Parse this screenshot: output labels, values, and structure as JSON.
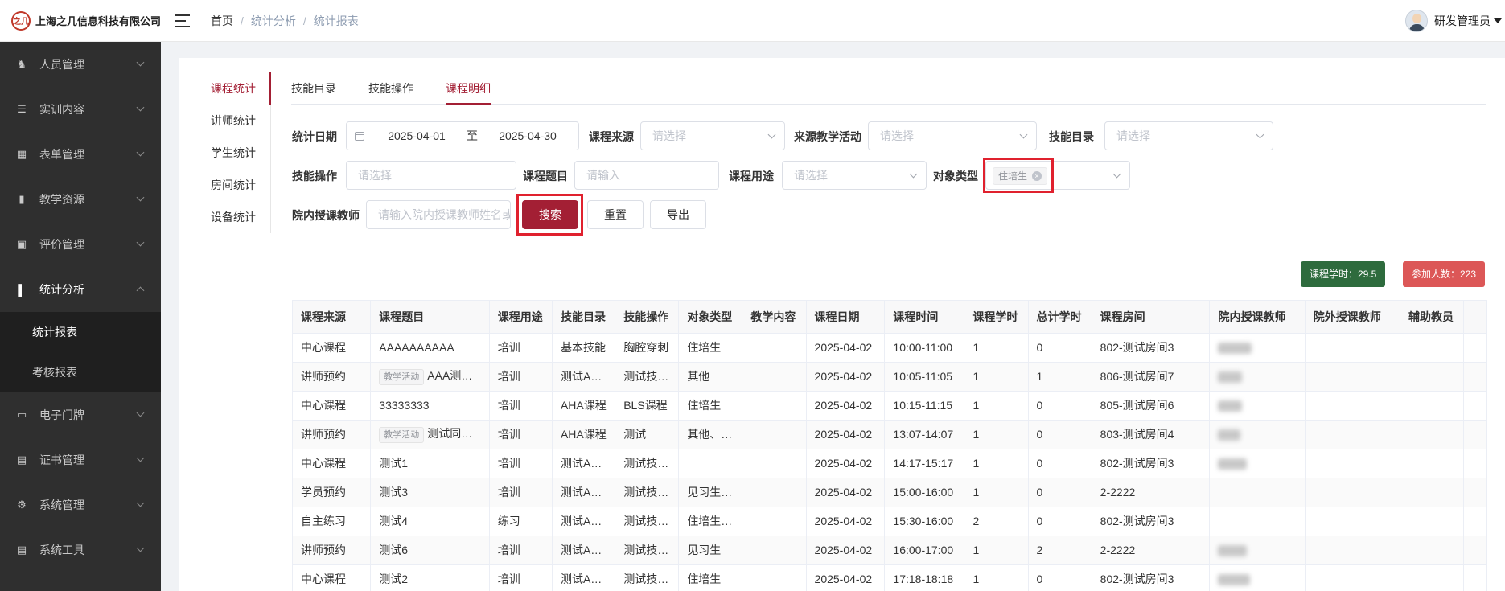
{
  "header": {
    "company": "上海之几信息科技有限公司",
    "logo_mark": "之几",
    "breadcrumb": [
      "首页",
      "统计分析",
      "统计报表"
    ],
    "user_name": "研发管理员"
  },
  "sidebar": {
    "items": [
      {
        "label": "人员管理",
        "icon": "users-icon"
      },
      {
        "label": "实训内容",
        "icon": "training-icon"
      },
      {
        "label": "表单管理",
        "icon": "form-icon"
      },
      {
        "label": "教学资源",
        "icon": "book-icon"
      },
      {
        "label": "评价管理",
        "icon": "evaluation-icon"
      },
      {
        "label": "统计分析",
        "icon": "bar-chart-icon"
      },
      {
        "label": "电子门牌",
        "icon": "monitor-icon"
      },
      {
        "label": "证书管理",
        "icon": "certificate-icon"
      },
      {
        "label": "系统管理",
        "icon": "gear-icon"
      },
      {
        "label": "系统工具",
        "icon": "toolbox-icon"
      }
    ],
    "sub_items": [
      "统计报表",
      "考核报表"
    ]
  },
  "left_nav": [
    "课程统计",
    "讲师统计",
    "学生统计",
    "房间统计",
    "设备统计"
  ],
  "tabs": [
    "技能目录",
    "技能操作",
    "课程明细"
  ],
  "filters": {
    "stat_date_label": "统计日期",
    "date_start": "2025-04-01",
    "date_sep": "至",
    "date_end": "2025-04-30",
    "course_source_label": "课程来源",
    "course_source_placeholder": "请选择",
    "source_activity_label": "来源教学活动",
    "source_activity_placeholder": "请选择",
    "skill_catalog_label": "技能目录",
    "skill_catalog_placeholder": "请选择",
    "skill_operation_label": "技能操作",
    "skill_operation_placeholder": "请选择",
    "course_title_label": "课程题目",
    "course_title_placeholder": "请输入",
    "course_purpose_label": "课程用途",
    "course_purpose_placeholder": "请选择",
    "target_type_label": "对象类型",
    "target_type_tag": "住培生",
    "teacher_label": "院内授课教师",
    "teacher_placeholder": "请输入院内授课教师姓名或"
  },
  "buttons": {
    "search": "搜索",
    "reset": "重置",
    "export": "导出"
  },
  "stats": {
    "hours": "课程学时：29.5",
    "participants": "参加人数：223"
  },
  "table": {
    "columns": [
      "课程来源",
      "课程题目",
      "课程用途",
      "技能目录",
      "技能操作",
      "对象类型",
      "教学内容",
      "课程日期",
      "课程时间",
      "课程学时",
      "总计学时",
      "课程房间",
      "院内授课教师",
      "院外授课教师",
      "辅助教员"
    ],
    "rows": [
      {
        "source": "中心课程",
        "tag": "",
        "title": "AAAAAAAAAA",
        "purpose": "培训",
        "catalog": "基本技能",
        "operation": "胸腔穿刺",
        "target": "住培生",
        "content": "",
        "date": "2025-04-02",
        "time": "10:00-11:00",
        "hours": "1",
        "total": "0",
        "room": "802-测试房间3",
        "teacher_blurred": true
      },
      {
        "source": "讲师预约",
        "tag": "教学活动",
        "title": "AAA测…",
        "purpose": "培训",
        "catalog": "测试A…",
        "operation": "测试技…",
        "target": "其他",
        "content": "",
        "date": "2025-04-02",
        "time": "10:05-11:05",
        "hours": "1",
        "total": "1",
        "room": "806-测试房间7",
        "teacher_blurred": true
      },
      {
        "source": "中心课程",
        "tag": "",
        "title": "33333333",
        "purpose": "培训",
        "catalog": "AHA课程",
        "operation": "BLS课程",
        "target": "住培生",
        "content": "",
        "date": "2025-04-02",
        "time": "10:15-11:15",
        "hours": "1",
        "total": "0",
        "room": "805-测试房间6",
        "teacher_blurred": true
      },
      {
        "source": "讲师预约",
        "tag": "教学活动",
        "title": "测试同…",
        "purpose": "培训",
        "catalog": "AHA课程",
        "operation": "测试",
        "target": "其他、…",
        "content": "",
        "date": "2025-04-02",
        "time": "13:07-14:07",
        "hours": "1",
        "total": "0",
        "room": "803-测试房间4",
        "teacher_blurred": true
      },
      {
        "source": "中心课程",
        "tag": "",
        "title": "测试1",
        "purpose": "培训",
        "catalog": "测试A…",
        "operation": "测试技…",
        "target": "",
        "content": "",
        "date": "2025-04-02",
        "time": "14:17-15:17",
        "hours": "1",
        "total": "0",
        "room": "802-测试房间3",
        "teacher_blurred": true
      },
      {
        "source": "学员预约",
        "tag": "",
        "title": "测试3",
        "purpose": "培训",
        "catalog": "测试A…",
        "operation": "测试技…",
        "target": "见习生…",
        "content": "",
        "date": "2025-04-02",
        "time": "15:00-16:00",
        "hours": "1",
        "total": "0",
        "room": "2-2222",
        "teacher_blurred": false
      },
      {
        "source": "自主练习",
        "tag": "",
        "title": "测试4",
        "purpose": "练习",
        "catalog": "测试A…",
        "operation": "测试技…",
        "target": "住培生…",
        "content": "",
        "date": "2025-04-02",
        "time": "15:30-16:00",
        "hours": "2",
        "total": "0",
        "room": "802-测试房间3",
        "teacher_blurred": false
      },
      {
        "source": "讲师预约",
        "tag": "",
        "title": "测试6",
        "purpose": "培训",
        "catalog": "测试A…",
        "operation": "测试技…",
        "target": "见习生",
        "content": "",
        "date": "2025-04-02",
        "time": "16:00-17:00",
        "hours": "1",
        "total": "2",
        "room": "2-2222",
        "teacher_blurred": true
      },
      {
        "source": "中心课程",
        "tag": "",
        "title": "测试2",
        "purpose": "培训",
        "catalog": "测试A…",
        "operation": "测试技…",
        "target": "住培生",
        "content": "",
        "date": "2025-04-02",
        "time": "17:18-18:18",
        "hours": "1",
        "total": "0",
        "room": "802-测试房间3",
        "teacher_blurred": true
      }
    ]
  },
  "colors": {
    "accent": "#a31f34",
    "sidebar_bg": "#2f2f2f",
    "stat_green": "#2e6b3d",
    "stat_red": "#dc5757",
    "highlight": "#e0212e"
  }
}
